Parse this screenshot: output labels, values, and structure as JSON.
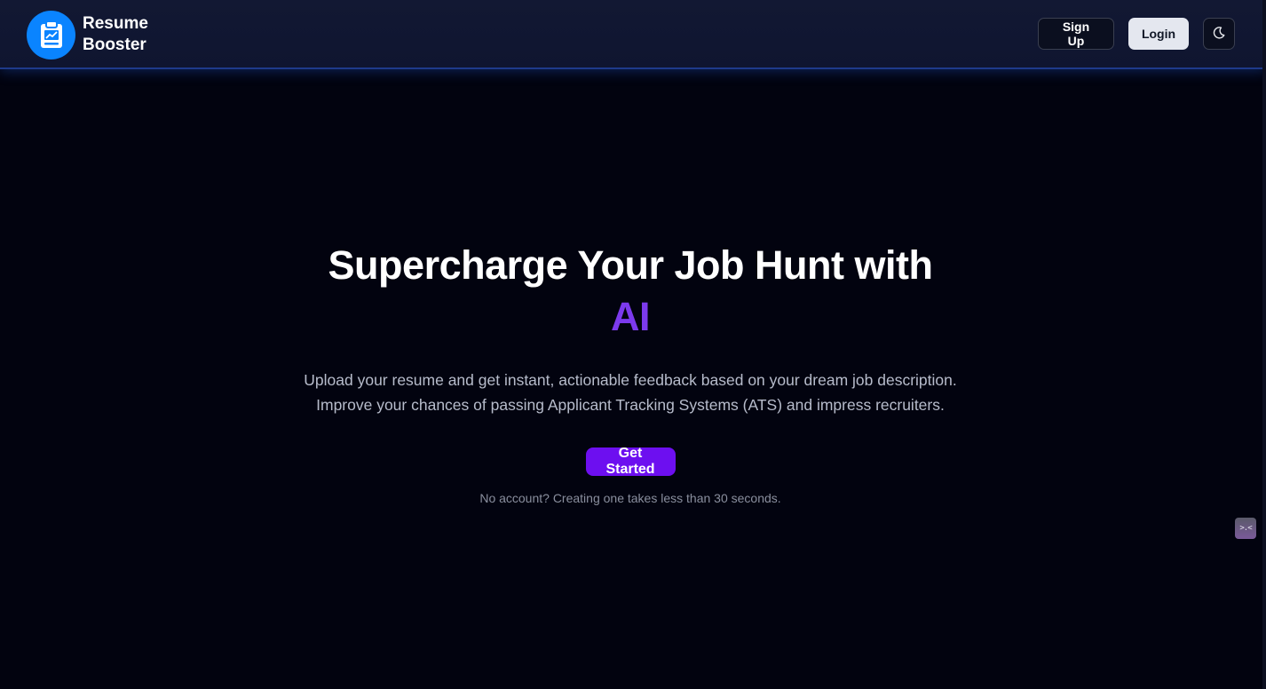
{
  "brand": {
    "name": "Resume Booster",
    "logo_icon": "clipboard-chart-icon",
    "logo_color": "#0a84ff"
  },
  "nav": {
    "signup_label": "Sign Up",
    "login_label": "Login",
    "theme_icon": "moon-icon"
  },
  "hero": {
    "title_main": "Supercharge Your Job Hunt with",
    "title_accent": "AI",
    "accent_color": "#7c3aed",
    "subtitle_line1": "Upload your resume and get instant, actionable feedback based on your dream job description.",
    "subtitle_line2": "Improve your chances of passing Applicant Tracking Systems (ATS) and impress recruiters.",
    "cta_label": "Get Started",
    "cta_color": "#6d0ff0",
    "note": "No account? Creating one takes less than 30 seconds."
  },
  "widget": {
    "icon": "dev-tools-face-icon",
    "glyph": ">.<"
  }
}
